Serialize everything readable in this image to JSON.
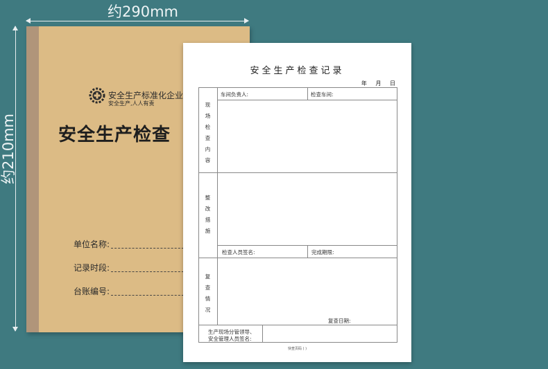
{
  "dimensions": {
    "width_label": "约290mm",
    "height_label": "约210mm"
  },
  "cover": {
    "org_name": "安全生产标准化企业",
    "slogan": "安全生产,人人有责",
    "title": "安全生产检查",
    "fields": [
      {
        "label": "单位名称:"
      },
      {
        "label": "记录时段:"
      },
      {
        "label": "台账编号:"
      }
    ],
    "color": "#dcbb85"
  },
  "sheet": {
    "title": "安全生产检查记录",
    "date_label": "年 月 日",
    "rows": {
      "supervisor_label": "车间负责人:",
      "workshop_label": "检查车间:",
      "inspection_content_label": "现场检查内容",
      "rectification_label": "整改措施",
      "inspector_label": "检查人员签名:",
      "deadline_label": "完成期限:",
      "recheck_label": "复查情况",
      "recheck_date_label": "复查日期:",
      "sign_label_line1": "生产现场分管领导、",
      "sign_label_line2": "安全管理人员签名:"
    },
    "footer": "快查页码 (     )"
  }
}
